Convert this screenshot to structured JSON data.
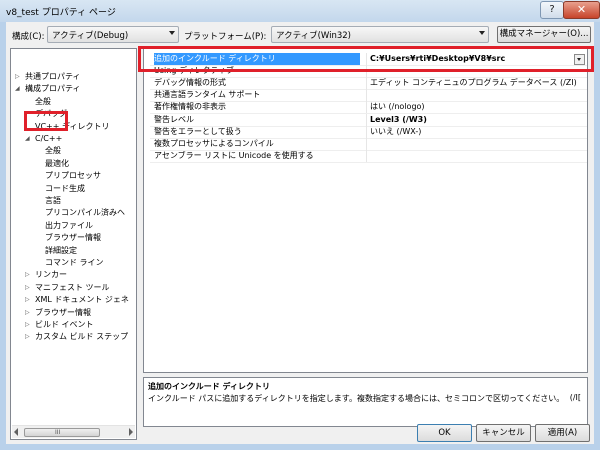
{
  "window": {
    "title": "v8_test プロパティ ページ",
    "help": "?",
    "close": "✕"
  },
  "config": {
    "config_label": "構成(C):",
    "config_value": "アクティブ(Debug)",
    "platform_label": "プラットフォーム(P):",
    "platform_value": "アクティブ(Win32)",
    "manager_button": "構成マネージャー(O)..."
  },
  "tree": {
    "items": [
      {
        "label": "共通プロパティ",
        "expander": "▷"
      },
      {
        "label": "構成プロパティ",
        "expander": "◢"
      },
      {
        "label": "全般",
        "expander": ""
      },
      {
        "label": "デバッグ",
        "expander": ""
      },
      {
        "label": "VC++ ディレクトリ",
        "expander": ""
      },
      {
        "label": "C/C++",
        "expander": "◢"
      },
      {
        "label": "全般",
        "expander": ""
      },
      {
        "label": "最適化",
        "expander": ""
      },
      {
        "label": "プリプロセッサ",
        "expander": ""
      },
      {
        "label": "コード生成",
        "expander": ""
      },
      {
        "label": "言語",
        "expander": ""
      },
      {
        "label": "プリコンパイル済みヘ",
        "expander": ""
      },
      {
        "label": "出力ファイル",
        "expander": ""
      },
      {
        "label": "ブラウザー情報",
        "expander": ""
      },
      {
        "label": "詳細設定",
        "expander": ""
      },
      {
        "label": "コマンド ライン",
        "expander": ""
      },
      {
        "label": "リンカー",
        "expander": "▷"
      },
      {
        "label": "マニフェスト ツール",
        "expander": "▷"
      },
      {
        "label": "XML ドキュメント ジェネ",
        "expander": "▷"
      },
      {
        "label": "ブラウザー情報",
        "expander": "▷"
      },
      {
        "label": "ビルド イベント",
        "expander": "▷"
      },
      {
        "label": "カスタム ビルド ステップ",
        "expander": "▷"
      }
    ],
    "scroll_grip": "III"
  },
  "grid": {
    "rows": [
      {
        "name": "追加のインクルード ディレクトリ",
        "value": "C:¥Users¥rti¥Desktop¥V8¥src"
      },
      {
        "name": "Using ディレクティブ",
        "value": ""
      },
      {
        "name": "デバッグ情報の形式",
        "value": "エディット コンティニュのプログラム データベース (/ZI)"
      },
      {
        "name": "共通言語ランタイム サポート",
        "value": ""
      },
      {
        "name": "著作権情報の非表示",
        "value": "はい (/nologo)"
      },
      {
        "name": "警告レベル",
        "value": "Level3 (/W3)"
      },
      {
        "name": "警告をエラーとして扱う",
        "value": "いいえ (/WX-)"
      },
      {
        "name": "複数プロセッサによるコンパイル",
        "value": ""
      },
      {
        "name": "アセンブラー リストに Unicode を使用する",
        "value": ""
      }
    ]
  },
  "description": {
    "title": "追加のインクルード ディレクトリ",
    "text": "インクルード パスに追加するディレクトリを指定します。複数指定する場合には、セミコロンで区切ってください。",
    "trailing": "(/I["
  },
  "buttons": {
    "ok": "OK",
    "cancel": "キャンセル",
    "apply": "適用(A)"
  },
  "colors": {
    "highlight": "#e0202a",
    "selection": "#3399ff"
  }
}
